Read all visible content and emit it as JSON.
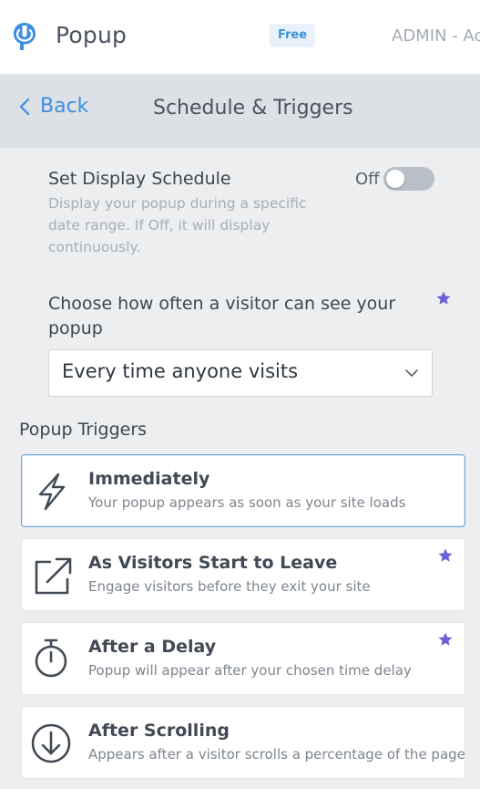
{
  "header": {
    "app_name": "Popup",
    "plan_badge": "Free",
    "admin_label": "ADMIN - Ac"
  },
  "subheader": {
    "back_label": "Back",
    "title": "Schedule & Triggers"
  },
  "schedule": {
    "title": "Set Display Schedule",
    "description": "Display your popup during a specific date range. If Off, it will display continuously.",
    "toggle_label": "Off",
    "toggle_on": false
  },
  "frequency": {
    "label": "Choose how often a visitor can see your popup",
    "selected": "Every time anyone visits",
    "premium": true
  },
  "triggers": {
    "title": "Popup Triggers",
    "items": [
      {
        "name": "Immediately",
        "description": "Your popup appears as soon as your site loads",
        "icon": "lightning-icon",
        "selected": true,
        "premium": false
      },
      {
        "name": "As Visitors Start to Leave",
        "description": "Engage visitors before they exit your site",
        "icon": "exit-arrow-icon",
        "selected": false,
        "premium": true
      },
      {
        "name": "After a Delay",
        "description": "Popup will appear after your chosen time delay",
        "icon": "stopwatch-icon",
        "selected": false,
        "premium": true
      },
      {
        "name": "After Scrolling",
        "description": "Appears after a visitor scrolls a percentage of the page",
        "icon": "scroll-down-icon",
        "selected": false,
        "premium": false
      }
    ]
  },
  "colors": {
    "accent_blue": "#3d8fe0",
    "premium_star": "#6a5fd3",
    "toggle_off": "#b9bfc6"
  }
}
